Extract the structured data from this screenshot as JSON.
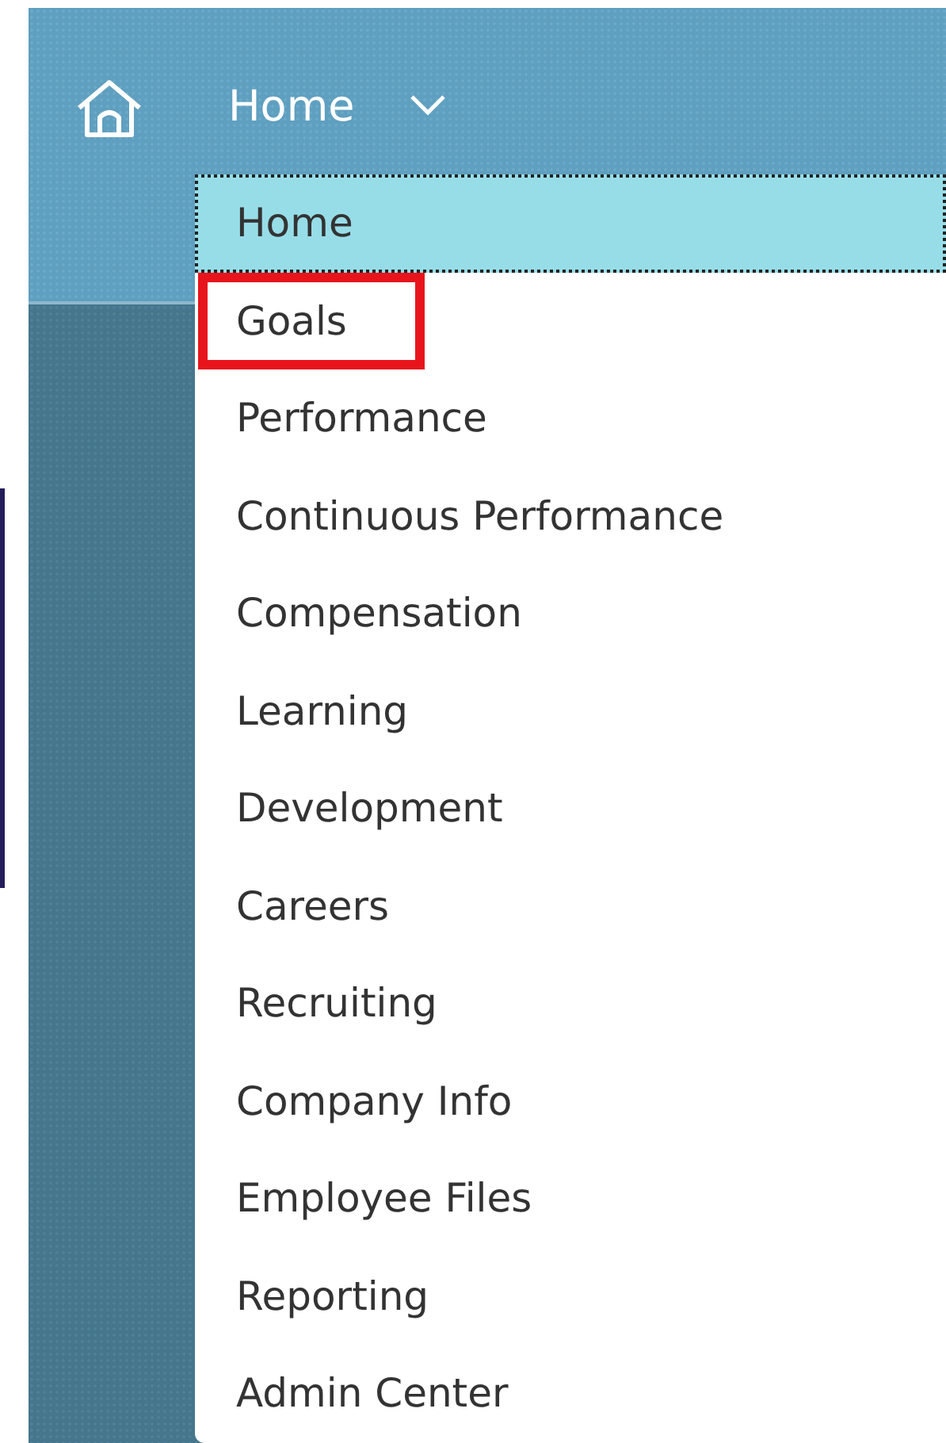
{
  "header": {
    "title": "Home",
    "menu_expanded": true
  },
  "menu": {
    "items": [
      {
        "label": "Home",
        "selected": true,
        "highlighted": false
      },
      {
        "label": "Goals",
        "selected": false,
        "highlighted": true
      },
      {
        "label": "Performance",
        "selected": false,
        "highlighted": false
      },
      {
        "label": "Continuous Performance",
        "selected": false,
        "highlighted": false
      },
      {
        "label": "Compensation",
        "selected": false,
        "highlighted": false
      },
      {
        "label": "Learning",
        "selected": false,
        "highlighted": false
      },
      {
        "label": "Development",
        "selected": false,
        "highlighted": false
      },
      {
        "label": "Careers",
        "selected": false,
        "highlighted": false
      },
      {
        "label": "Recruiting",
        "selected": false,
        "highlighted": false
      },
      {
        "label": "Company Info",
        "selected": false,
        "highlighted": false
      },
      {
        "label": "Employee Files",
        "selected": false,
        "highlighted": false
      },
      {
        "label": "Reporting",
        "selected": false,
        "highlighted": false
      },
      {
        "label": "Admin Center",
        "selected": false,
        "highlighted": false
      }
    ]
  }
}
